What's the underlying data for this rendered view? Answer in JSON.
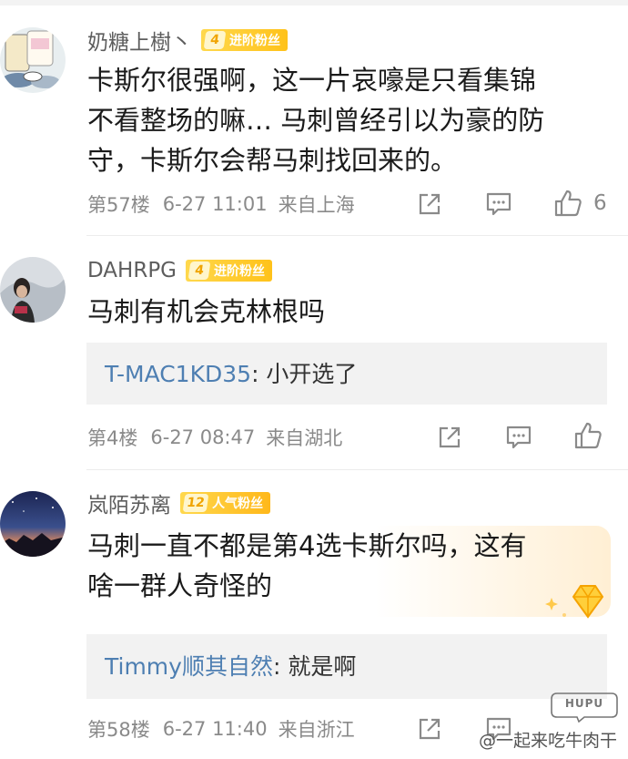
{
  "comments": [
    {
      "username": "奶糖上樹丶",
      "badge_level": "4",
      "badge_text": "进阶粉丝",
      "lines": [
        "卡斯尔很强啊，这一片哀嚎是只看集锦",
        "不看整场的嘛… 马刺曾经引以为豪的防",
        "守，卡斯尔会帮马刺找回来的。"
      ],
      "floor": "第57楼",
      "time": "6-27 11:01",
      "location": "来自上海",
      "likes": "6"
    },
    {
      "username": "DAHRPG",
      "badge_level": "4",
      "badge_text": "进阶粉丝",
      "lines": [
        "马刺有机会克林根吗"
      ],
      "reply_user": "T-MAC1KD35",
      "reply_text": ": 小开选了",
      "floor": "第4楼",
      "time": "6-27 08:47",
      "location": "来自湖北",
      "likes": ""
    },
    {
      "username": "岚陌苏离",
      "badge_level": "12",
      "badge_text": "人气粉丝",
      "lines": [
        "马刺一直不都是第4选卡斯尔吗，这有",
        "啥一群人奇怪的"
      ],
      "reply_user": "Timmy顺其自然",
      "reply_text": ": 就是啊",
      "floor": "第58楼",
      "time": "6-27 11:40",
      "location": "来自浙江",
      "likes": ""
    }
  ],
  "watermark": "@一起来吃牛肉干",
  "watermark_logo": "HUPU",
  "colors": {
    "badge": "#ffc21a",
    "reply_user": "#4e7fb2",
    "meta": "#8a8a8a"
  },
  "icons": [
    "share-icon",
    "comment-icon",
    "like-icon"
  ]
}
